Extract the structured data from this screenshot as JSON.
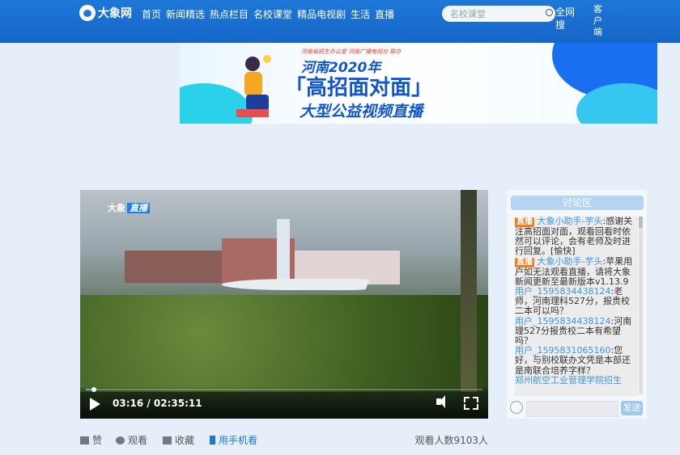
{
  "header": {
    "logo_text": "大象网",
    "nav": [
      "首页",
      "新闻精选",
      "热点栏目",
      "名校课堂",
      "精品电视剧",
      "生活",
      "直播"
    ],
    "search_value": "名校课堂",
    "search_button": "全网搜",
    "client": "客户端"
  },
  "banner": {
    "subtitle": "河南省招生办公室 河南广播电视台 联办",
    "line1": "河南2020年",
    "line2": "「高招面对面」",
    "line3": "大型公益视频直播"
  },
  "video": {
    "watermark_logo": "大象",
    "watermark_tag": "直播",
    "time": "03:16 / 02:35:11",
    "progress_fraction": 0.021
  },
  "chat": {
    "title": "讨论区",
    "messages": [
      {
        "badge": "直播",
        "user": "大象小助手-芋头",
        "text": "感谢关注高招面对面，观看回看时依然可以评论，会有老师及时进行回复。[愉快]"
      },
      {
        "badge": "直播",
        "user": "大象小助手-芋头",
        "text": "苹果用户如无法观看直播，请将大象新闻更新至最新版本v1.13.9"
      },
      {
        "badge": "",
        "user": "用户_1595834438124",
        "text": "老师，河南理科527分，报贵校二本可以吗？"
      },
      {
        "badge": "",
        "user": "用户_1595834438124",
        "text": "河南理527分报贵校二本有希望吗？"
      },
      {
        "badge": "",
        "user": "用户_1595831065160",
        "text": "您好，与别校联办文凭是本部还是南联合培养字样？"
      },
      {
        "badge": "",
        "user": "",
        "text": "郑州航空工业管理学院招生"
      }
    ],
    "send": "发送"
  },
  "actions": {
    "like": "赞",
    "watch": "观看",
    "favorite": "收藏",
    "mobile": "用手机看",
    "viewers": "观看人数9103人"
  },
  "colors": {
    "accent": "#1e78d6",
    "badge": "#f27c21",
    "username": "#3f96e0"
  }
}
